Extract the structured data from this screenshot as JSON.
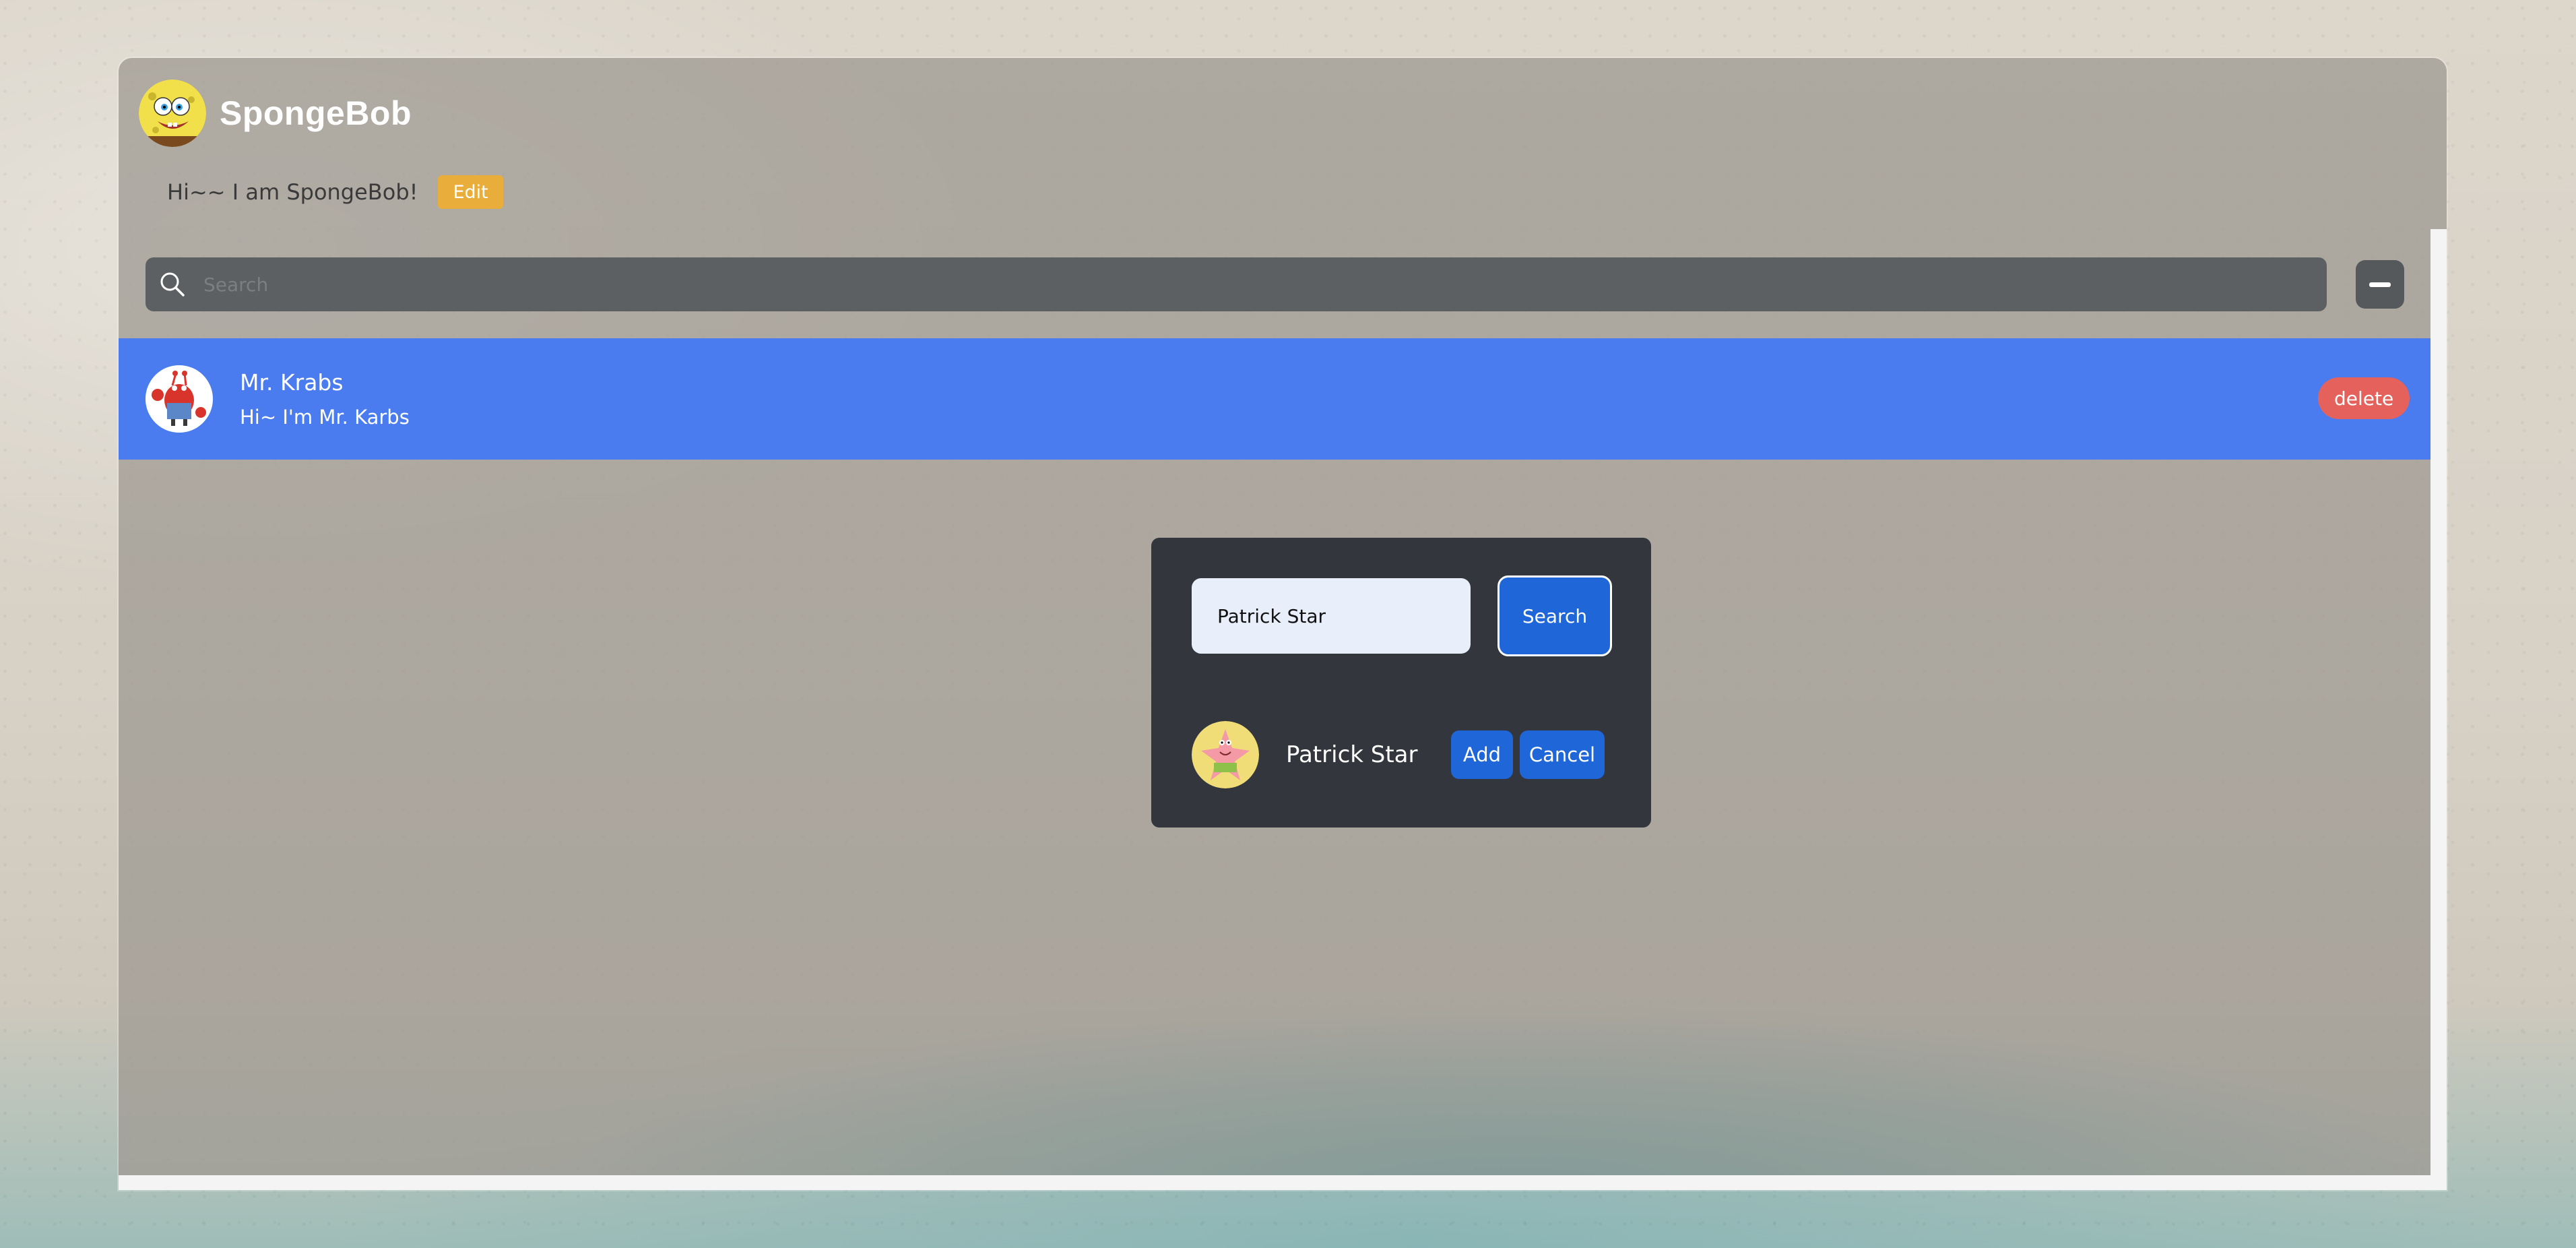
{
  "profile": {
    "name": "SpongeBob",
    "status": "Hi~~ I am SpongeBob!",
    "edit_label": "Edit",
    "avatar_icon": "spongebob-avatar"
  },
  "search": {
    "placeholder": "Search",
    "value": ""
  },
  "contacts": [
    {
      "name": "Mr. Krabs",
      "bio": "Hi~ I'm Mr. Karbs",
      "delete_label": "delete",
      "avatar_icon": "mr-krabs-avatar"
    }
  ],
  "add_friend_modal": {
    "input_value": "Patrick Star",
    "search_label": "Search",
    "result": {
      "name": "Patrick Star",
      "avatar_icon": "patrick-star-avatar"
    },
    "add_label": "Add",
    "cancel_label": "Cancel"
  },
  "colors": {
    "selected_row": "#4a7cf0",
    "primary_button": "#1f66d9",
    "edit_button": "#e8ad3b",
    "delete_button": "#e4625b",
    "modal_background": "#33363c",
    "search_bar": "#5c6063"
  },
  "icons": {
    "search": "search-icon",
    "collapse": "minus-icon"
  }
}
